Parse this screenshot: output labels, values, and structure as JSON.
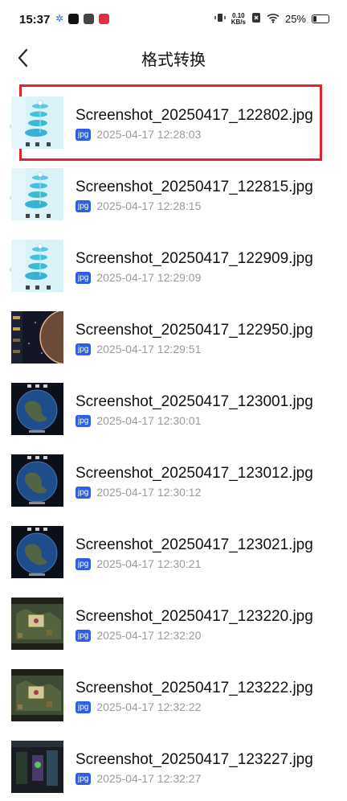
{
  "status_bar": {
    "time": "15:37",
    "net_speed_value": "0.10",
    "net_speed_unit": "KB/s",
    "battery": "25%",
    "battery_level": 0.25
  },
  "header": {
    "back_icon": "chevron-left-icon",
    "title": "格式转换"
  },
  "files": [
    {
      "name": "Screenshot_20250417_122802.jpg",
      "type": "jpg",
      "date": "2025-04-17 12:28:03",
      "thumb": "game-light",
      "selected": true
    },
    {
      "name": "Screenshot_20250417_122815.jpg",
      "type": "jpg",
      "date": "2025-04-17 12:28:15",
      "thumb": "game-light"
    },
    {
      "name": "Screenshot_20250417_122909.jpg",
      "type": "jpg",
      "date": "2025-04-17 12:29:09",
      "thumb": "game-light"
    },
    {
      "name": "Screenshot_20250417_122950.jpg",
      "type": "jpg",
      "date": "2025-04-17 12:29:51",
      "thumb": "space-dark"
    },
    {
      "name": "Screenshot_20250417_123001.jpg",
      "type": "jpg",
      "date": "2025-04-17 12:30:01",
      "thumb": "earth"
    },
    {
      "name": "Screenshot_20250417_123012.jpg",
      "type": "jpg",
      "date": "2025-04-17 12:30:12",
      "thumb": "earth"
    },
    {
      "name": "Screenshot_20250417_123021.jpg",
      "type": "jpg",
      "date": "2025-04-17 12:30:21",
      "thumb": "earth"
    },
    {
      "name": "Screenshot_20250417_123220.jpg",
      "type": "jpg",
      "date": "2025-04-17 12:32:20",
      "thumb": "strategy"
    },
    {
      "name": "Screenshot_20250417_123222.jpg",
      "type": "jpg",
      "date": "2025-04-17 12:32:22",
      "thumb": "strategy"
    },
    {
      "name": "Screenshot_20250417_123227.jpg",
      "type": "jpg",
      "date": "2025-04-17 12:32:27",
      "thumb": "game-menu"
    }
  ],
  "colors": {
    "highlight": "#e0232f",
    "badge": "#2f5fe0"
  }
}
